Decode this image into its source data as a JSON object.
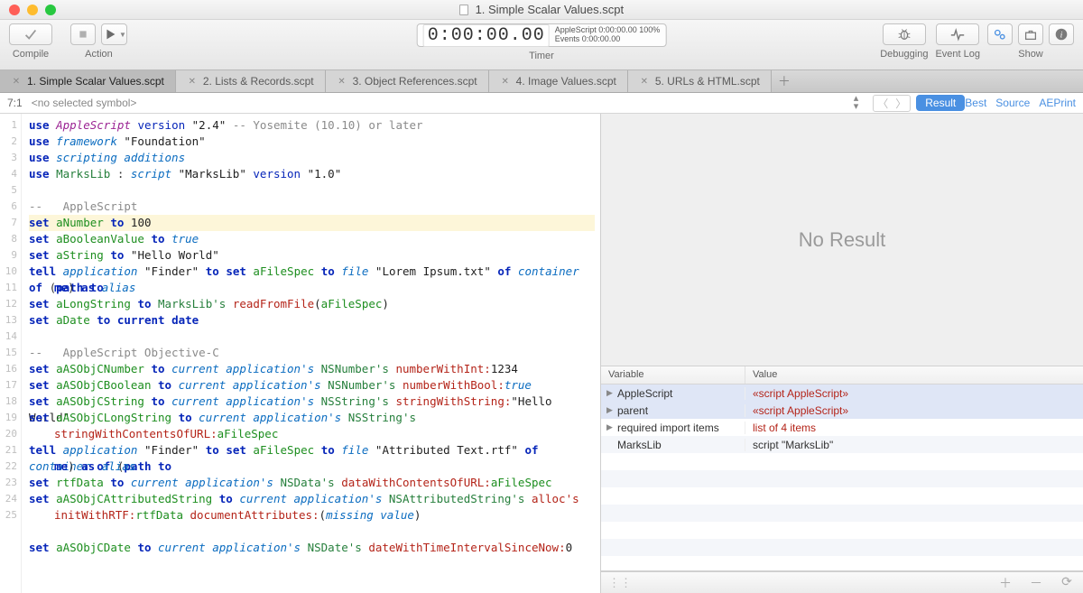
{
  "window": {
    "title": "1. Simple Scalar Values.scpt"
  },
  "toolbar": {
    "compile_label": "Compile",
    "action_label": "Action",
    "timer_label": "Timer",
    "debugging_label": "Debugging",
    "eventlog_label": "Event Log",
    "show_label": "Show",
    "timer_digits": "0:00:00.00",
    "timer_sub1": "AppleScript 0:00:00.00 100%",
    "timer_sub2": "Events 0:00:00.00"
  },
  "tabs": [
    "1. Simple Scalar Values.scpt",
    "2. Lists & Records.scpt",
    "3. Object References.scpt",
    "4. Image Values.scpt",
    "5. URLs & HTML.scpt"
  ],
  "symbolbar": {
    "position": "7:1",
    "symbol": "<no selected symbol>",
    "result_pill": "Result",
    "modes": [
      "Best",
      "Source",
      "AEPrint"
    ]
  },
  "code": {
    "lines": [
      {
        "n": 1,
        "t": [
          [
            "kw",
            "use"
          ],
          [
            "sp",
            " "
          ],
          [
            "cmd",
            "AppleScript"
          ],
          [
            "sp",
            " "
          ],
          [
            "kw2",
            "version"
          ],
          [
            "sp",
            " "
          ],
          [
            "str",
            "\"2.4\""
          ],
          [
            "sp",
            " "
          ],
          [
            "cmt",
            "-- Yosemite (10.10) or later"
          ]
        ]
      },
      {
        "n": 2,
        "t": [
          [
            "kw",
            "use"
          ],
          [
            "sp",
            " "
          ],
          [
            "ital",
            "framework"
          ],
          [
            "sp",
            " "
          ],
          [
            "str",
            "\"Foundation\""
          ]
        ]
      },
      {
        "n": 3,
        "t": [
          [
            "kw",
            "use"
          ],
          [
            "sp",
            " "
          ],
          [
            "ital",
            "scripting additions"
          ]
        ]
      },
      {
        "n": 4,
        "t": [
          [
            "kw",
            "use"
          ],
          [
            "sp",
            " "
          ],
          [
            "cls",
            "MarksLib"
          ],
          [
            "sp",
            " : "
          ],
          [
            "ital",
            "script"
          ],
          [
            "sp",
            " "
          ],
          [
            "str",
            "\"MarksLib\""
          ],
          [
            "sp",
            " "
          ],
          [
            "kw2",
            "version"
          ],
          [
            "sp",
            " "
          ],
          [
            "str",
            "\"1.0\""
          ]
        ]
      },
      {
        "n": 5,
        "t": []
      },
      {
        "n": 6,
        "t": [
          [
            "cmt",
            "--   AppleScript"
          ]
        ]
      },
      {
        "n": 7,
        "hl": true,
        "t": [
          [
            "kw",
            "set"
          ],
          [
            "sp",
            " "
          ],
          [
            "var",
            "aNumber"
          ],
          [
            "sp",
            " "
          ],
          [
            "kw",
            "to"
          ],
          [
            "sp",
            " "
          ],
          [
            "num",
            "100"
          ]
        ]
      },
      {
        "n": 8,
        "t": [
          [
            "kw",
            "set"
          ],
          [
            "sp",
            " "
          ],
          [
            "var",
            "aBooleanValue"
          ],
          [
            "sp",
            " "
          ],
          [
            "kw",
            "to"
          ],
          [
            "sp",
            " "
          ],
          [
            "ital",
            "true"
          ]
        ]
      },
      {
        "n": 9,
        "t": [
          [
            "kw",
            "set"
          ],
          [
            "sp",
            " "
          ],
          [
            "var",
            "aString"
          ],
          [
            "sp",
            " "
          ],
          [
            "kw",
            "to"
          ],
          [
            "sp",
            " "
          ],
          [
            "str",
            "\"Hello World\""
          ]
        ]
      },
      {
        "n": 10,
        "t": [
          [
            "kw",
            "tell"
          ],
          [
            "sp",
            " "
          ],
          [
            "ital",
            "application"
          ],
          [
            "sp",
            " "
          ],
          [
            "str",
            "\"Finder\""
          ],
          [
            "sp",
            " "
          ],
          [
            "kw",
            "to"
          ],
          [
            "sp",
            " "
          ],
          [
            "kw",
            "set"
          ],
          [
            "sp",
            " "
          ],
          [
            "var",
            "aFileSpec"
          ],
          [
            "sp",
            " "
          ],
          [
            "kw",
            "to"
          ],
          [
            "sp",
            " "
          ],
          [
            "ital",
            "file"
          ],
          [
            "sp",
            " "
          ],
          [
            "str",
            "\"Lorem Ipsum.txt\""
          ],
          [
            "sp",
            " "
          ],
          [
            "kw",
            "of"
          ],
          [
            "sp",
            " "
          ],
          [
            "ital",
            "container"
          ],
          [
            "sp",
            " "
          ],
          [
            "kw",
            "of"
          ],
          [
            "sp",
            " ("
          ],
          [
            "kw",
            "path to"
          ]
        ]
      },
      {
        "n": "",
        "cont": true,
        "t": [
          [
            "kw",
            "me"
          ],
          [
            "sp",
            ") "
          ],
          [
            "kw",
            "as"
          ],
          [
            "sp",
            " "
          ],
          [
            "ital",
            "alias"
          ]
        ]
      },
      {
        "n": 11,
        "t": [
          [
            "kw",
            "set"
          ],
          [
            "sp",
            " "
          ],
          [
            "var",
            "aLongString"
          ],
          [
            "sp",
            " "
          ],
          [
            "kw",
            "to"
          ],
          [
            "sp",
            " "
          ],
          [
            "cls",
            "MarksLib's"
          ],
          [
            "sp",
            " "
          ],
          [
            "meth",
            "readFromFile"
          ],
          [
            "punct",
            "("
          ],
          [
            "var",
            "aFileSpec"
          ],
          [
            "punct",
            ")"
          ]
        ]
      },
      {
        "n": 12,
        "t": [
          [
            "kw",
            "set"
          ],
          [
            "sp",
            " "
          ],
          [
            "var",
            "aDate"
          ],
          [
            "sp",
            " "
          ],
          [
            "kw",
            "to"
          ],
          [
            "sp",
            " "
          ],
          [
            "kw",
            "current date"
          ]
        ]
      },
      {
        "n": 13,
        "t": []
      },
      {
        "n": 14,
        "t": [
          [
            "cmt",
            "--   AppleScript Objective-C"
          ]
        ]
      },
      {
        "n": 15,
        "t": [
          [
            "kw",
            "set"
          ],
          [
            "sp",
            " "
          ],
          [
            "var",
            "aASObjCNumber"
          ],
          [
            "sp",
            " "
          ],
          [
            "kw",
            "to"
          ],
          [
            "sp",
            " "
          ],
          [
            "ital",
            "current application's"
          ],
          [
            "sp",
            " "
          ],
          [
            "cls",
            "NSNumber's"
          ],
          [
            "sp",
            " "
          ],
          [
            "meth",
            "numberWithInt:"
          ],
          [
            "num",
            "1234"
          ]
        ]
      },
      {
        "n": 16,
        "t": [
          [
            "kw",
            "set"
          ],
          [
            "sp",
            " "
          ],
          [
            "var",
            "aASObjCBoolean"
          ],
          [
            "sp",
            " "
          ],
          [
            "kw",
            "to"
          ],
          [
            "sp",
            " "
          ],
          [
            "ital",
            "current application's"
          ],
          [
            "sp",
            " "
          ],
          [
            "cls",
            "NSNumber's"
          ],
          [
            "sp",
            " "
          ],
          [
            "meth",
            "numberWithBool:"
          ],
          [
            "ital",
            "true"
          ]
        ]
      },
      {
        "n": 17,
        "t": [
          [
            "kw",
            "set"
          ],
          [
            "sp",
            " "
          ],
          [
            "var",
            "aASObjCString"
          ],
          [
            "sp",
            " "
          ],
          [
            "kw",
            "to"
          ],
          [
            "sp",
            " "
          ],
          [
            "ital",
            "current application's"
          ],
          [
            "sp",
            " "
          ],
          [
            "cls",
            "NSString's"
          ],
          [
            "sp",
            " "
          ],
          [
            "meth",
            "stringWithString:"
          ],
          [
            "str",
            "\"Hello World\""
          ]
        ]
      },
      {
        "n": 18,
        "t": [
          [
            "kw",
            "set"
          ],
          [
            "sp",
            " "
          ],
          [
            "var",
            "aASObjCLongString"
          ],
          [
            "sp",
            " "
          ],
          [
            "kw",
            "to"
          ],
          [
            "sp",
            " "
          ],
          [
            "ital",
            "current application's"
          ],
          [
            "sp",
            " "
          ],
          [
            "cls",
            "NSString's"
          ]
        ]
      },
      {
        "n": "",
        "cont": true,
        "t": [
          [
            "meth",
            "stringWithContentsOfURL:"
          ],
          [
            "var",
            "aFileSpec"
          ]
        ]
      },
      {
        "n": 19,
        "t": [
          [
            "kw",
            "tell"
          ],
          [
            "sp",
            " "
          ],
          [
            "ital",
            "application"
          ],
          [
            "sp",
            " "
          ],
          [
            "str",
            "\"Finder\""
          ],
          [
            "sp",
            " "
          ],
          [
            "kw",
            "to"
          ],
          [
            "sp",
            " "
          ],
          [
            "kw",
            "set"
          ],
          [
            "sp",
            " "
          ],
          [
            "var",
            "aFileSpec"
          ],
          [
            "sp",
            " "
          ],
          [
            "kw",
            "to"
          ],
          [
            "sp",
            " "
          ],
          [
            "ital",
            "file"
          ],
          [
            "sp",
            " "
          ],
          [
            "str",
            "\"Attributed Text.rtf\""
          ],
          [
            "sp",
            " "
          ],
          [
            "kw",
            "of"
          ],
          [
            "sp",
            " "
          ],
          [
            "ital",
            "container"
          ],
          [
            "sp",
            " "
          ],
          [
            "kw",
            "of"
          ],
          [
            "sp",
            " ("
          ],
          [
            "kw",
            "path to"
          ]
        ]
      },
      {
        "n": "",
        "cont": true,
        "t": [
          [
            "kw",
            "me"
          ],
          [
            "sp",
            ") "
          ],
          [
            "kw",
            "as"
          ],
          [
            "sp",
            " "
          ],
          [
            "ital",
            "alias"
          ]
        ]
      },
      {
        "n": 20,
        "t": [
          [
            "kw",
            "set"
          ],
          [
            "sp",
            " "
          ],
          [
            "var",
            "rtfData"
          ],
          [
            "sp",
            " "
          ],
          [
            "kw",
            "to"
          ],
          [
            "sp",
            " "
          ],
          [
            "ital",
            "current application's"
          ],
          [
            "sp",
            " "
          ],
          [
            "cls",
            "NSData's"
          ],
          [
            "sp",
            " "
          ],
          [
            "meth",
            "dataWithContentsOfURL:"
          ],
          [
            "var",
            "aFileSpec"
          ]
        ]
      },
      {
        "n": 21,
        "t": [
          [
            "kw",
            "set"
          ],
          [
            "sp",
            " "
          ],
          [
            "var",
            "aASObjCAttributedString"
          ],
          [
            "sp",
            " "
          ],
          [
            "kw",
            "to"
          ],
          [
            "sp",
            " "
          ],
          [
            "ital",
            "current application's"
          ],
          [
            "sp",
            " "
          ],
          [
            "cls",
            "NSAttributedString's"
          ],
          [
            "sp",
            " "
          ],
          [
            "meth",
            "alloc's"
          ]
        ]
      },
      {
        "n": "",
        "cont": true,
        "t": [
          [
            "meth",
            "initWithRTF:"
          ],
          [
            "var",
            "rtfData"
          ],
          [
            "sp",
            " "
          ],
          [
            "meth",
            "documentAttributes:"
          ],
          [
            "punct",
            "("
          ],
          [
            "ital",
            "missing value"
          ],
          [
            "punct",
            ")"
          ]
        ]
      },
      {
        "n": 22,
        "t": []
      },
      {
        "n": 23,
        "t": [
          [
            "kw",
            "set"
          ],
          [
            "sp",
            " "
          ],
          [
            "var",
            "aASObjCDate"
          ],
          [
            "sp",
            " "
          ],
          [
            "kw",
            "to"
          ],
          [
            "sp",
            " "
          ],
          [
            "ital",
            "current application's"
          ],
          [
            "sp",
            " "
          ],
          [
            "cls",
            "NSDate's"
          ],
          [
            "sp",
            " "
          ],
          [
            "meth",
            "dateWithTimeIntervalSinceNow:"
          ],
          [
            "num",
            "0"
          ]
        ]
      },
      {
        "n": 24,
        "t": []
      },
      {
        "n": 25,
        "t": []
      }
    ]
  },
  "result": {
    "empty_text": "No Result"
  },
  "vars": {
    "header_var": "Variable",
    "header_val": "Value",
    "rows": [
      {
        "name": "AppleScript",
        "value": "«script AppleScript»",
        "disclose": true,
        "red": true,
        "sel": true
      },
      {
        "name": "parent",
        "value": "«script AppleScript»",
        "disclose": true,
        "red": true,
        "sel": true
      },
      {
        "name": "required import items",
        "value": "list of 4 items",
        "disclose": true,
        "red": true,
        "sel": false
      },
      {
        "name": "MarksLib",
        "value": "script \"MarksLib\"",
        "disclose": false,
        "red": false,
        "sel": false
      }
    ]
  }
}
